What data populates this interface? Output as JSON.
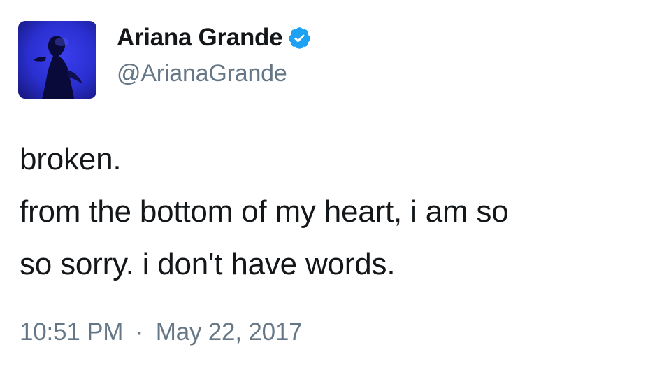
{
  "author": {
    "display_name": "Ariana Grande",
    "handle": "@ArianaGrande",
    "verified": true,
    "avatar_icon": "profile-photo-concert-silhouette",
    "verified_icon": "verified-badge-icon"
  },
  "tweet": {
    "lines": [
      "broken.",
      "from the bottom of my heart, i am so",
      "so sorry. i don't have words."
    ]
  },
  "meta": {
    "time": "10:51 PM",
    "separator": "·",
    "date": "May 22, 2017"
  },
  "colors": {
    "text_primary": "#14171a",
    "text_secondary": "#657786",
    "verified_blue": "#1da1f2",
    "avatar_bg": "#2a2fd0"
  }
}
